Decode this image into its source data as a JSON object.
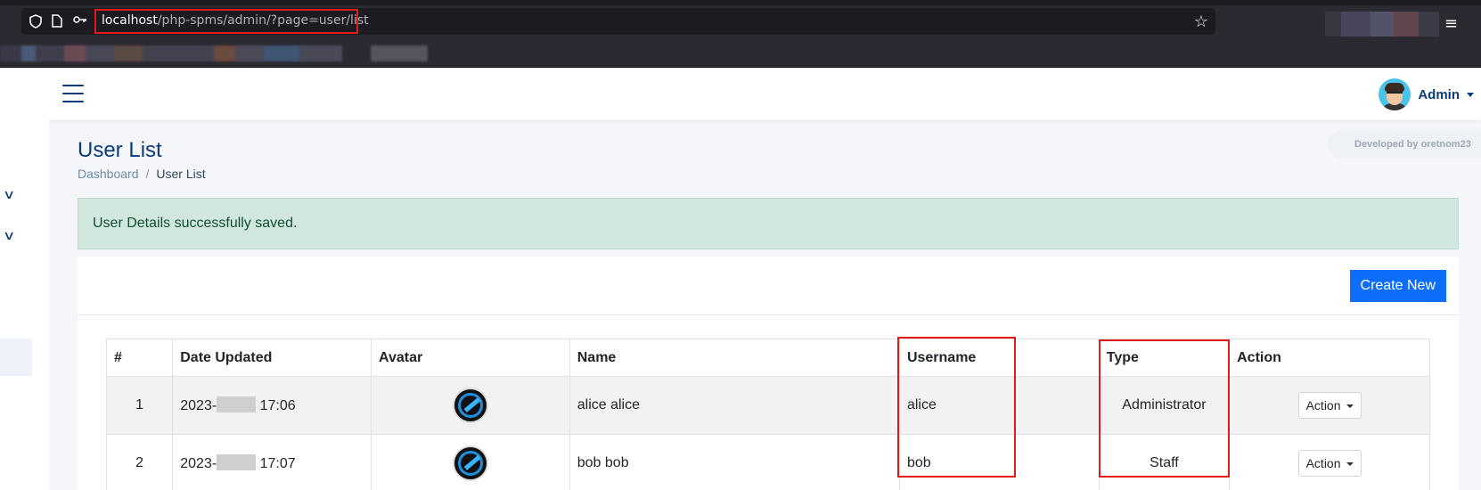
{
  "browser": {
    "url_host": "localhost",
    "url_path": "/php-spms/admin/?page=user/list"
  },
  "header": {
    "user_name": "Admin"
  },
  "page": {
    "title": "User List",
    "breadcrumb": {
      "home": "Dashboard",
      "separator": "/",
      "current": "User List"
    },
    "developer_badge": "Developed by oretnom23"
  },
  "alert": {
    "message": "User Details successfully saved."
  },
  "card": {
    "create_button": "Create New"
  },
  "table": {
    "headers": [
      "#",
      "Date Updated",
      "Avatar",
      "Name",
      "Username",
      "Type",
      "Action"
    ],
    "rows": [
      {
        "num": "1",
        "date_prefix": "2023-",
        "time": "17:06",
        "name": "alice alice",
        "username": "alice",
        "type": "Administrator",
        "action": "Action"
      },
      {
        "num": "2",
        "date_prefix": "2023-",
        "time": "17:07",
        "name": "bob bob",
        "username": "bob",
        "type": "Staff",
        "action": "Action"
      }
    ]
  },
  "colors": {
    "accent": "#0d6efd",
    "highlight": "#e11a1a",
    "alert_bg": "#d1e7dd",
    "brand_text": "#0b3b7a"
  },
  "icons": [
    "shield-icon",
    "page-icon",
    "key-icon",
    "star-icon",
    "menu-icon",
    "hamburger-icon",
    "chevron-down-icon"
  ]
}
